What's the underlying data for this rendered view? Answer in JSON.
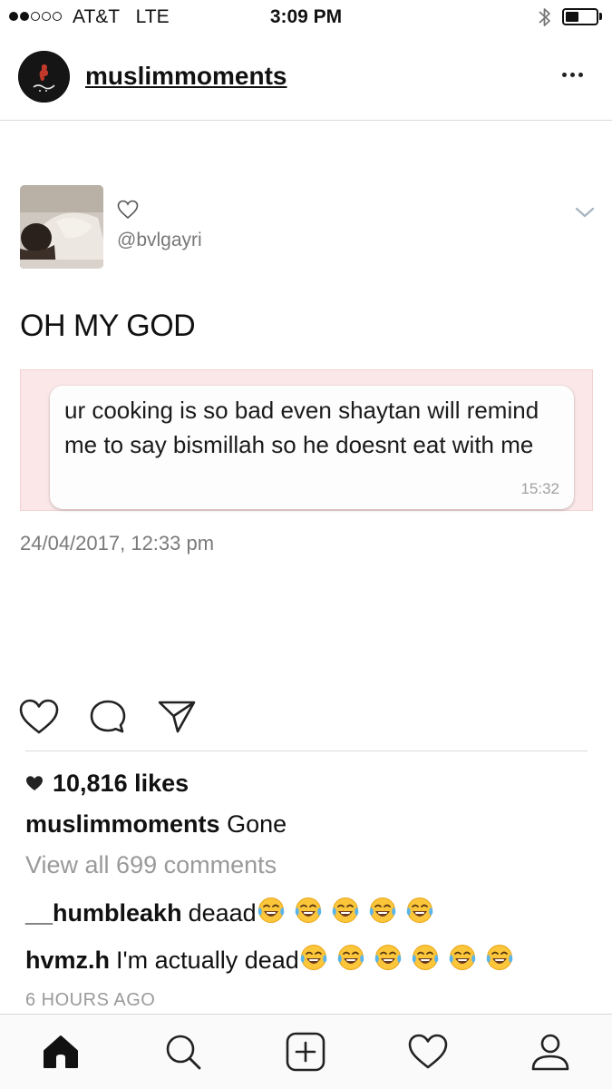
{
  "status_bar": {
    "carrier": "AT&T",
    "network": "LTE",
    "time": "3:09 PM",
    "signal_bars_filled": 2,
    "signal_bars_total": 5,
    "battery_level": 0.45
  },
  "post": {
    "username": "muslimmoments",
    "avatar_icon": "brand-logo-avatar",
    "more_icon": "more-options-icon"
  },
  "tweet": {
    "handle": "@bvlgayri",
    "text": "OH MY GOD",
    "embedded_message": "ur cooking is so bad even shaytan will remind me to say bismillah so he doesnt eat with me",
    "embedded_time": "15:32",
    "date": "24/04/2017, 12:33 pm",
    "background_color": "#fbe7e7"
  },
  "likes": "10,816 likes",
  "caption": {
    "username": "muslimmoments",
    "text": "Gone"
  },
  "view_comments": "View all 699 comments",
  "comments": [
    {
      "username": "__humbleakh",
      "text": "deaad",
      "emoji_count": 5,
      "emoji": "face-with-tears-of-joy"
    },
    {
      "username": "hvmz.h",
      "text": "I'm actually dead",
      "emoji_count": 6,
      "emoji": "face-with-tears-of-joy"
    }
  ],
  "time_ago": "6 HOURS AGO",
  "tab_bar": {
    "tabs": [
      "home-icon",
      "search-icon",
      "add-post-icon",
      "activity-heart-icon",
      "profile-icon"
    ],
    "active": "home-icon"
  }
}
